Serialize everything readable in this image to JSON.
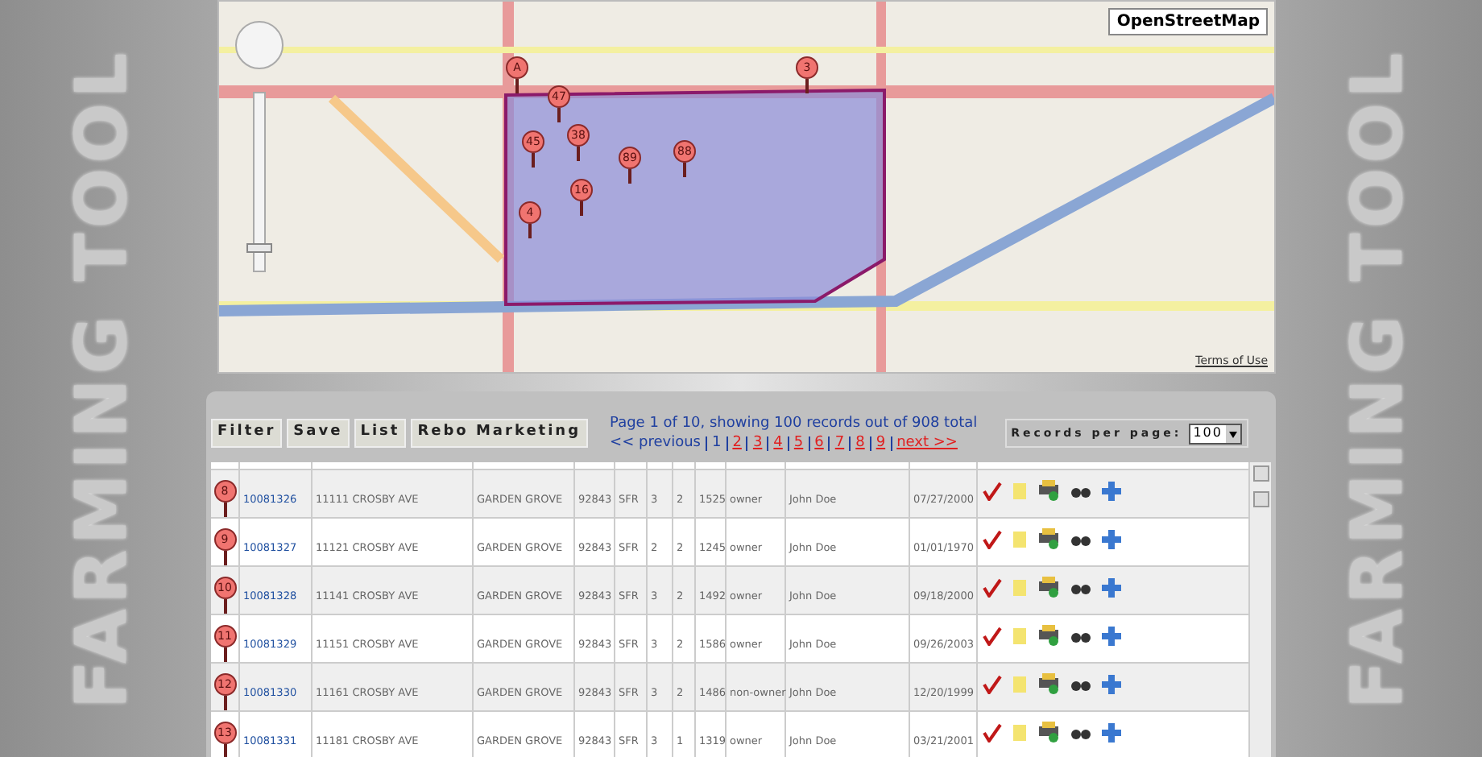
{
  "side_titles": [
    "FARMING TOOL",
    "FARMING TOOL"
  ],
  "map": {
    "zoom": {
      "level": 0.1
    },
    "layer_button": "OpenStreetMap",
    "terms_link": "Terms of Use",
    "markers": [
      {
        "label": "A"
      },
      {
        "label": "3"
      },
      {
        "label": "16"
      },
      {
        "label": "47"
      },
      {
        "label": "38"
      },
      {
        "label": "45"
      },
      {
        "label": "89"
      },
      {
        "label": "88"
      },
      {
        "label": "4"
      }
    ]
  },
  "toolbar": {
    "buttons": [
      "Filter",
      "Save",
      "List",
      "Rebo Marketing"
    ]
  },
  "pagination": {
    "summary": "Page 1 of 10, showing 100 records out of 908 total",
    "previous": "<< previous",
    "pages": [
      {
        "label": "1",
        "selected": true
      },
      {
        "label": "2",
        "selected": false
      },
      {
        "label": "3",
        "selected": false
      },
      {
        "label": "4",
        "selected": false
      },
      {
        "label": "5",
        "selected": false
      },
      {
        "label": "6",
        "selected": false
      },
      {
        "label": "7",
        "selected": false
      },
      {
        "label": "8",
        "selected": false
      },
      {
        "label": "9",
        "selected": false
      }
    ],
    "next": "next >>"
  },
  "records_per_page": {
    "label": "Records per page:",
    "value": "100"
  },
  "table": {
    "rows": [
      {
        "marker": "8",
        "id": "10081326",
        "address": "11111 CROSBY AVE",
        "city": "GARDEN GROVE",
        "zip": "92843",
        "type": "SFR",
        "beds": "3",
        "baths": "2",
        "sqft": "1525",
        "occupancy": "owner",
        "owner": "John Doe",
        "date": "07/27/2000"
      },
      {
        "marker": "9",
        "id": "10081327",
        "address": "11121 CROSBY AVE",
        "city": "GARDEN GROVE",
        "zip": "92843",
        "type": "SFR",
        "beds": "2",
        "baths": "2",
        "sqft": "1245",
        "occupancy": "owner",
        "owner": "John Doe",
        "date": "01/01/1970"
      },
      {
        "marker": "10",
        "id": "10081328",
        "address": "11141 CROSBY AVE",
        "city": "GARDEN GROVE",
        "zip": "92843",
        "type": "SFR",
        "beds": "3",
        "baths": "2",
        "sqft": "1492",
        "occupancy": "owner",
        "owner": "John Doe",
        "date": "09/18/2000"
      },
      {
        "marker": "11",
        "id": "10081329",
        "address": "11151 CROSBY AVE",
        "city": "GARDEN GROVE",
        "zip": "92843",
        "type": "SFR",
        "beds": "3",
        "baths": "2",
        "sqft": "1586",
        "occupancy": "owner",
        "owner": "John Doe",
        "date": "09/26/2003"
      },
      {
        "marker": "12",
        "id": "10081330",
        "address": "11161 CROSBY AVE",
        "city": "GARDEN GROVE",
        "zip": "92843",
        "type": "SFR",
        "beds": "3",
        "baths": "2",
        "sqft": "1486",
        "occupancy": "non-owner",
        "owner": "John Doe",
        "date": "12/20/1999"
      },
      {
        "marker": "13",
        "id": "10081331",
        "address": "11181 CROSBY AVE",
        "city": "GARDEN GROVE",
        "zip": "92843",
        "type": "SFR",
        "beds": "3",
        "baths": "1",
        "sqft": "1319",
        "occupancy": "owner",
        "owner": "John Doe",
        "date": "03/21/2001"
      }
    ]
  }
}
